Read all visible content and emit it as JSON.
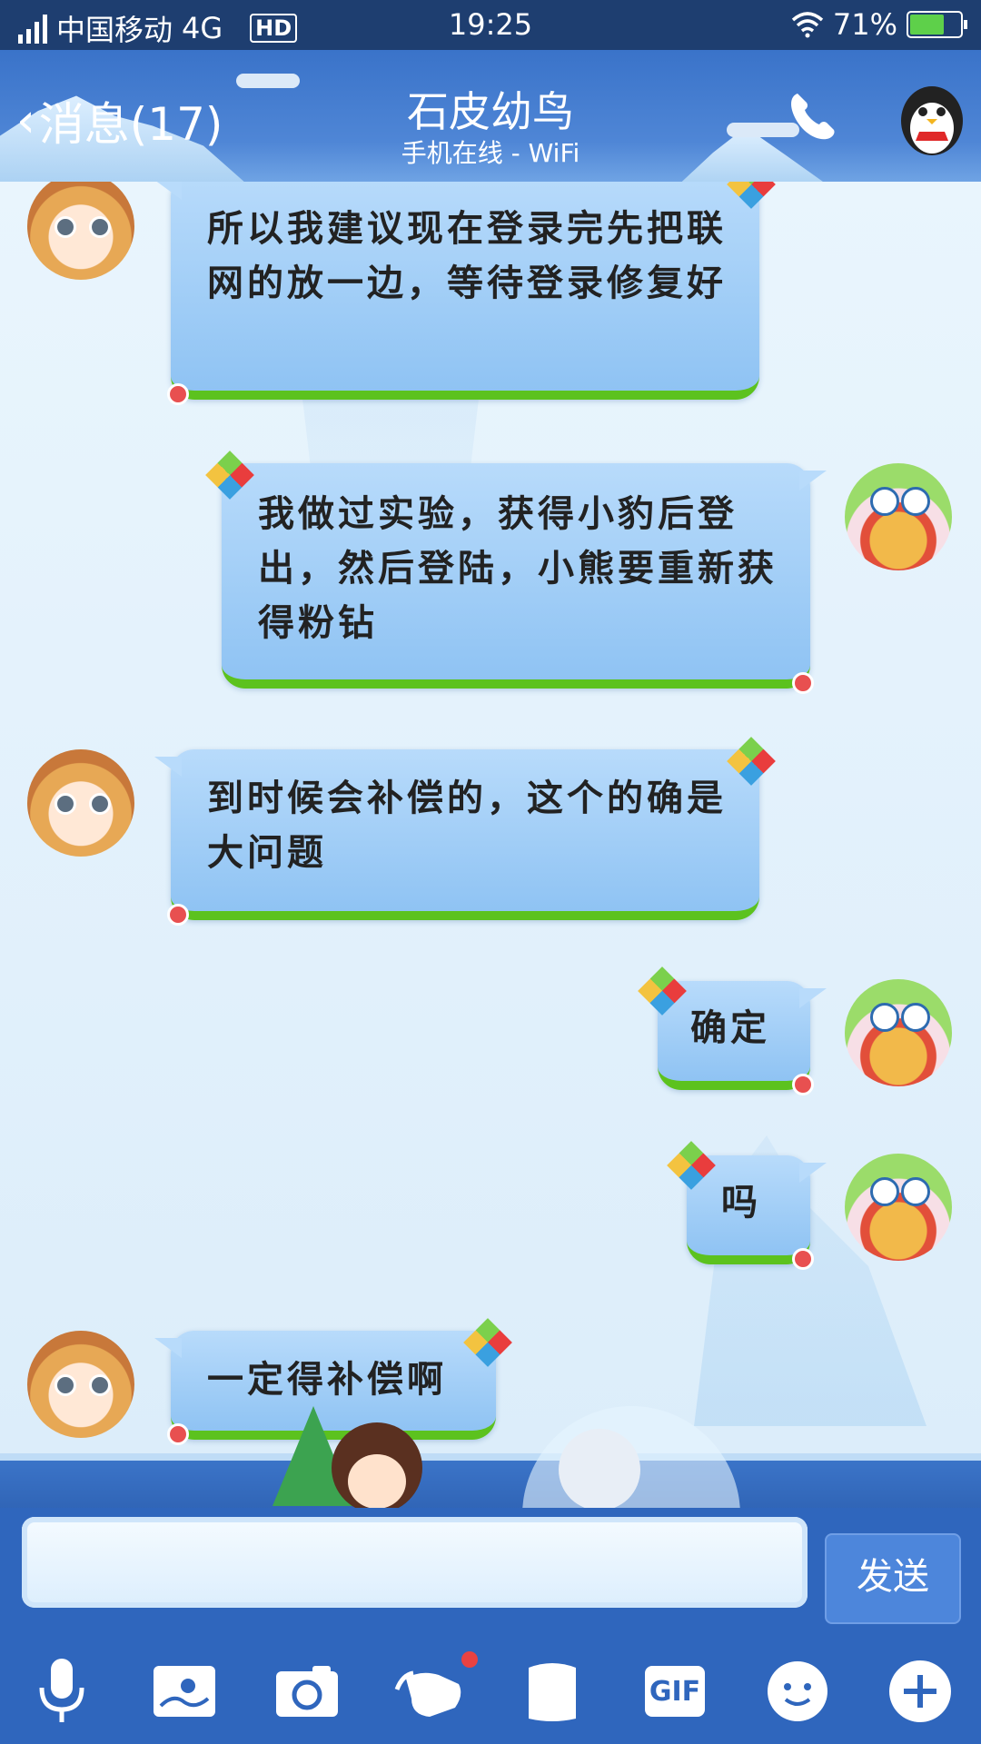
{
  "status_bar": {
    "carrier": "中国移动",
    "network": "4G",
    "hd": "HD",
    "time": "19:25",
    "battery": "71%",
    "battery_level": 0.71
  },
  "header": {
    "back_label": "消息(17)",
    "contact_name": "石皮幼鸟",
    "contact_status": "手机在线 - WiFi"
  },
  "messages": [
    {
      "side": "left",
      "text": "所以我建议现在登录完先把联网的放一边，等待登录修复好"
    },
    {
      "side": "right",
      "text": "我做过实验，获得小豹后登出，然后登陆，小熊要重新获得粉钻"
    },
    {
      "side": "left",
      "text": "到时候会补偿的，这个的确是大问题"
    },
    {
      "side": "right",
      "text": "确定"
    },
    {
      "side": "right",
      "text": "吗"
    },
    {
      "side": "left",
      "text": "一定得补偿啊"
    }
  ],
  "input": {
    "value": "",
    "send_label": "发送"
  },
  "toolbar": {
    "items": [
      {
        "icon": "microphone-icon"
      },
      {
        "icon": "image-icon"
      },
      {
        "icon": "camera-icon"
      },
      {
        "icon": "red-packet-icon",
        "badge": true
      },
      {
        "icon": "file-icon"
      },
      {
        "icon": "gif-icon",
        "label": "GIF"
      },
      {
        "icon": "emoji-icon"
      },
      {
        "icon": "plus-icon"
      }
    ]
  },
  "colors": {
    "header": "#3a73c9",
    "bubble": "#9fcdf6",
    "grass": "#5cc21e",
    "toolbar": "#2f66bd",
    "badge": "#e94242"
  }
}
